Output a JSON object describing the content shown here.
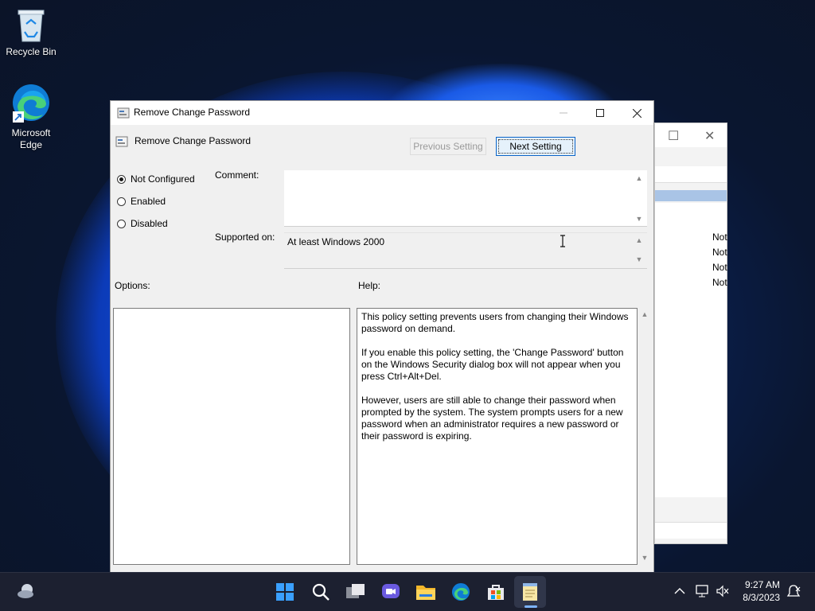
{
  "desktop": {
    "icons": [
      {
        "label": "Recycle Bin"
      },
      {
        "label": "Microsoft Edge"
      }
    ]
  },
  "background_window": {
    "rows": [
      "Not",
      "Not",
      "Not",
      "Not"
    ]
  },
  "dialog": {
    "title": "Remove Change Password",
    "setting_name": "Remove Change Password",
    "prev_button": "Previous Setting",
    "next_button": "Next Setting",
    "state_options": [
      {
        "label": "Not Configured",
        "selected": true
      },
      {
        "label": "Enabled",
        "selected": false
      },
      {
        "label": "Disabled",
        "selected": false
      }
    ],
    "comment_label": "Comment:",
    "comment_value": "",
    "supported_label": "Supported on:",
    "supported_value": "At least Windows 2000",
    "options_label": "Options:",
    "help_label": "Help:",
    "help_paragraphs": [
      "This policy setting prevents users from changing their Windows password on demand.",
      "If you enable this policy setting,  the 'Change Password' button on the Windows Security dialog box will not appear when you press Ctrl+Alt+Del.",
      "However, users are still able to change their password when prompted by the system. The system prompts users for a new password when an administrator requires a new password or their password is expiring."
    ]
  },
  "taskbar": {
    "time": "9:27 AM",
    "date": "8/3/2023",
    "apps": [
      "start-icon",
      "search-icon",
      "task-view-icon",
      "chat-icon",
      "file-explorer-icon",
      "edge-icon",
      "store-icon",
      "notepad-icon"
    ]
  },
  "colors": {
    "accent": "#0a64c8",
    "taskbar": "#1c2030"
  }
}
